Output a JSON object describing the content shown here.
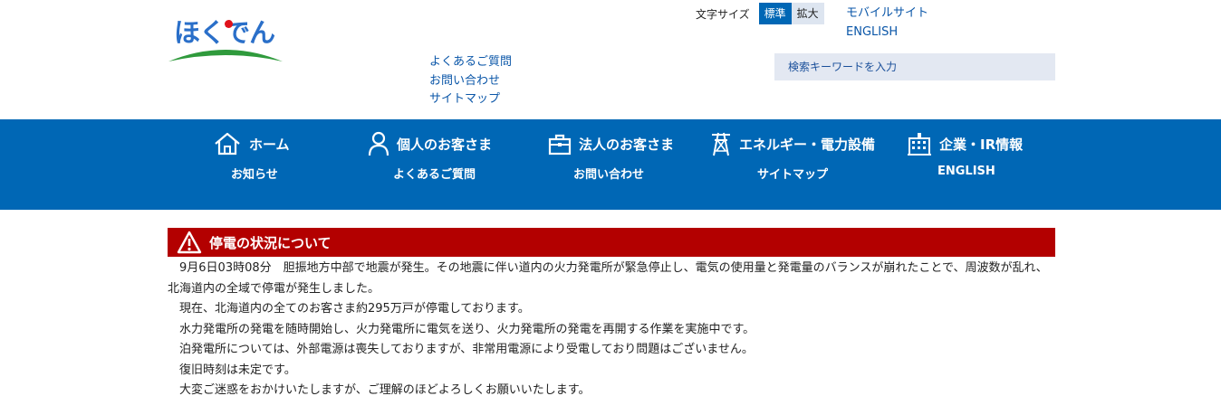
{
  "header": {
    "logo_text": "ほくでん",
    "font_size_label": "文字サイズ",
    "font_size_options": [
      "標準",
      "拡大"
    ],
    "top_links": [
      "モバイルサイト",
      "ENGLISH"
    ],
    "sub_links": [
      "よくあるご質問",
      "お問い合わせ",
      "サイトマップ"
    ],
    "search_placeholder": "検索キーワードを入力"
  },
  "nav": {
    "main": [
      {
        "label": "ホーム",
        "icon": "home-icon"
      },
      {
        "label": "個人のお客さま",
        "icon": "person-icon"
      },
      {
        "label": "法人のお客さま",
        "icon": "briefcase-icon"
      },
      {
        "label": "エネルギー・電力設備",
        "icon": "power-tower-icon"
      },
      {
        "label": "企業・IR情報",
        "icon": "building-icon"
      }
    ],
    "sub": [
      "お知らせ",
      "よくあるご質問",
      "お問い合わせ",
      "サイトマップ",
      "ENGLISH"
    ]
  },
  "alert": {
    "icon": "warning-icon",
    "title": "停電の状況について",
    "paragraphs": [
      "9月6日03時08分　胆振地方中部で地震が発生。その地震に伴い道内の火力発電所が緊急停止し、電気の使用量と発電量のバランスが崩れたことで、周波数が乱れ、北海道内の全域で停電が発生しました。",
      "現在、北海道内の全てのお客さま約295万戸が停電しております。",
      "水力発電所の発電を随時開始し、火力発電所に電気を送り、火力発電所の発電を再開する作業を実施中です。",
      "泊発電所については、外部電源は喪失しておりますが、非常用電源により受電しており問題はございません。",
      "復旧時刻は未定です。",
      "大変ご迷惑をおかけいたしますが、ご理解のほどよろしくお願いいたします。"
    ]
  },
  "colors": {
    "nav_bg": "#0067b5",
    "alert_bg": "#b30000",
    "link": "#0a56a8",
    "logo_blue": "#2a6fc9",
    "logo_green": "#2f9a3c"
  }
}
